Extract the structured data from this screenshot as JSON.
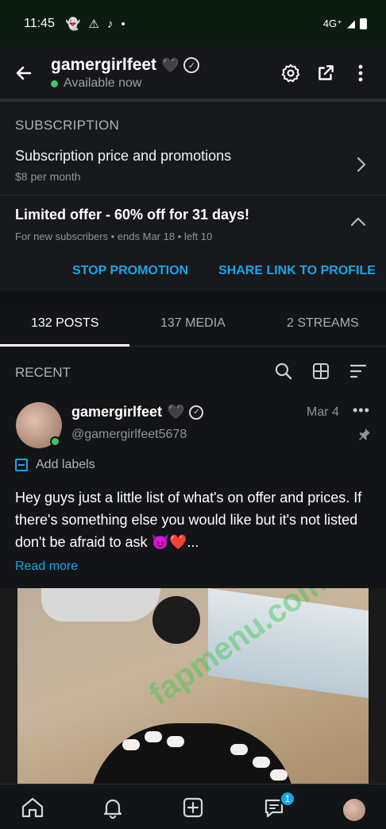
{
  "status_bar": {
    "time": "11:45",
    "network": "4G⁺"
  },
  "header": {
    "title": "gamergirlfeet",
    "heart": "🖤",
    "status": "Available now"
  },
  "subscription": {
    "section_title": "SUBSCRIPTION",
    "price_title": "Subscription price and promotions",
    "price_sub": "$8 per month",
    "offer_title": "Limited offer - 60% off for 31 days!",
    "offer_sub": "For new subscribers  •  ends Mar 18  •  left 10",
    "stop_label": "STOP PROMOTION",
    "share_label": "SHARE LINK TO PROFILE"
  },
  "tabs": [
    {
      "label": "132 POSTS",
      "active": true
    },
    {
      "label": "137 MEDIA",
      "active": false
    },
    {
      "label": "2 STREAMS",
      "active": false
    }
  ],
  "recent": {
    "label": "RECENT"
  },
  "post": {
    "author": "gamergirlfeet",
    "heart": "🖤",
    "handle": "@gamergirlfeet5678",
    "date": "Mar 4",
    "labels_label": "Add labels",
    "body": "Hey guys just a little list of what's on offer and prices. If there's something else you would like but it's not listed don't be afraid to ask 😈❤️...",
    "read_more": "Read more",
    "watermark": "fapmenu.com"
  },
  "bottom_nav": {
    "messages_badge": "1"
  },
  "colors": {
    "accent": "#1aa4e6",
    "online": "#3ec463"
  }
}
